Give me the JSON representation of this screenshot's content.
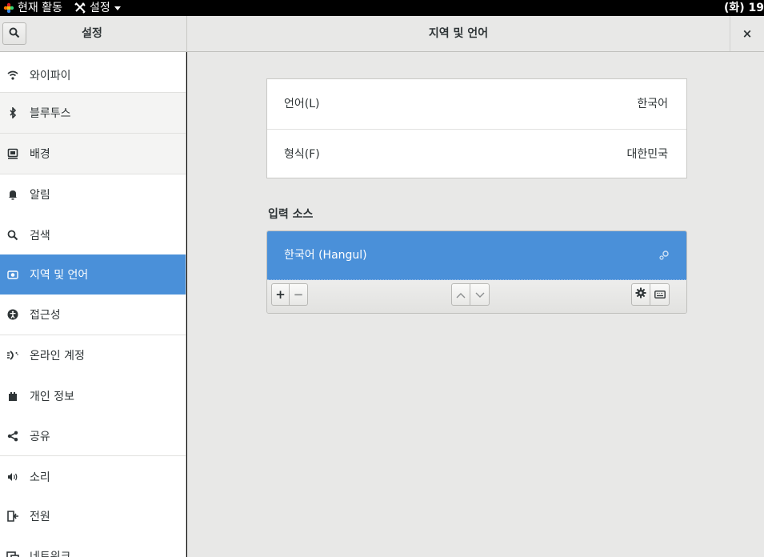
{
  "topbar": {
    "activities_label": "현재 활동",
    "app_menu_label": "설정",
    "clock": "(화) 19"
  },
  "header": {
    "left_title": "설정",
    "title": "지역 및 언어",
    "close_symbol": "×"
  },
  "sidebar": {
    "items": [
      {
        "label": "와이파이",
        "icon": "wifi-icon"
      },
      {
        "label": "블루투스",
        "icon": "bluetooth-icon"
      },
      {
        "label": "배경",
        "icon": "background-icon"
      },
      {
        "label": "알림",
        "icon": "bell-icon"
      },
      {
        "label": "검색",
        "icon": "search-icon"
      },
      {
        "label": "지역 및 언어",
        "icon": "region-icon"
      },
      {
        "label": "접근성",
        "icon": "accessibility-icon"
      },
      {
        "label": "온라인 계정",
        "icon": "online-accounts-icon"
      },
      {
        "label": "개인 정보",
        "icon": "privacy-hand-icon"
      },
      {
        "label": "공유",
        "icon": "share-icon"
      },
      {
        "label": "소리",
        "icon": "speaker-icon"
      },
      {
        "label": "전원",
        "icon": "power-icon"
      },
      {
        "label": "네트워크",
        "icon": "network-icon"
      }
    ]
  },
  "main": {
    "language": {
      "label": "언어(L)",
      "value": "한국어"
    },
    "formats": {
      "label": "형식(F)",
      "value": "대한민국"
    },
    "input_sources_title": "입력 소스",
    "input_sources": [
      {
        "label": "한국어 (Hangul)"
      }
    ],
    "toolbar": {
      "add": "+",
      "remove": "−"
    }
  },
  "colors": {
    "accent": "#4a90d9",
    "background": "#e8e8e7",
    "text": "#2e3436"
  }
}
